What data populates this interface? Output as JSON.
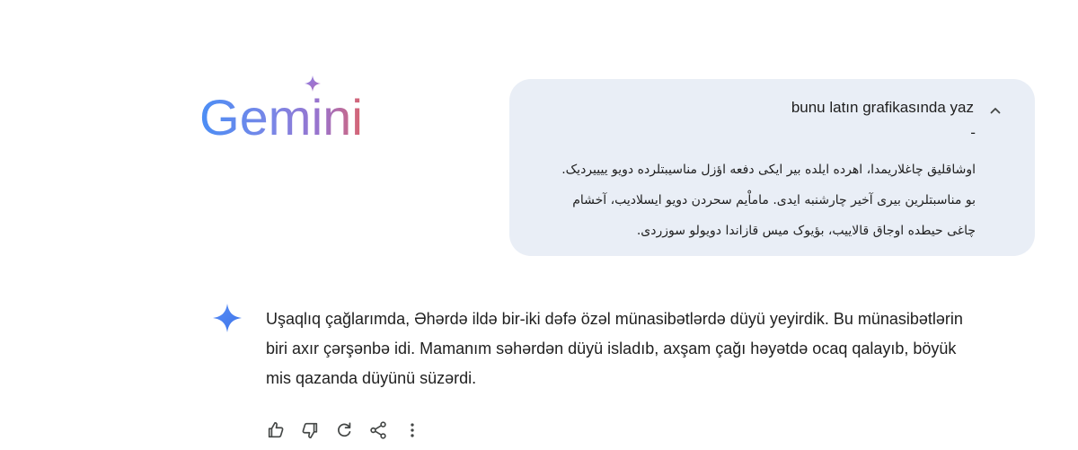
{
  "logo": {
    "text": "Gemini",
    "icon": "sparkle-icon"
  },
  "prompt": {
    "text": "bunu latın grafikasında yaz",
    "dash": "-",
    "collapse_icon": "chevron-up-icon",
    "arabic_lines": [
      "اوشاقلیق چاغلاریمدا، اهرده ایلده بیر ایکی دفعه اؤزل مناسیبتلرده دویو ییییردیک.",
      "بو مناسبتلرین بیری آخیر چارشنبه ایدی. ماماْیم سحردن دویو ایسلادیب، آخشام",
      "چاغی حیطده اوجاق قالاییب، بؤیوک میس قازاندا دویولو سوزردی."
    ]
  },
  "response": {
    "icon": "gemini-sparkle-icon",
    "lines": [
      "Uşaqlıq çağlarımda, Əhərdə ildə bir-iki dəfə özəl münasibətlərdə düyü yeyirdik. Bu münasibətlərin",
      "biri axır çərşənbə idi. Mamanım səhərdən düyü isladıb, axşam çağı həyətdə ocaq qalayıb, böyük",
      "mis qazanda düyünü süzərdi."
    ]
  },
  "actions": [
    {
      "name": "thumbs-up-icon"
    },
    {
      "name": "thumbs-down-icon"
    },
    {
      "name": "regenerate-icon"
    },
    {
      "name": "share-icon"
    },
    {
      "name": "more-options-icon"
    }
  ],
  "colors": {
    "prompt_bg": "#e9eef6",
    "text": "#1f1f1f",
    "icon": "#444746",
    "logo_gradient_start": "#4f8df5",
    "logo_gradient_mid": "#9b72cb",
    "logo_gradient_end": "#d96570"
  }
}
